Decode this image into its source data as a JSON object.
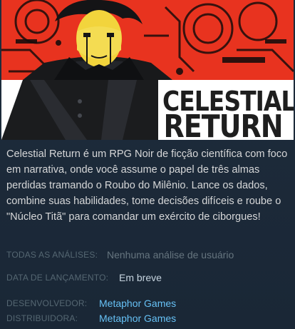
{
  "game": {
    "logo_line1": "CELESTIAL",
    "logo_line2": "RETURN",
    "description": "Celestial Return é um RPG Noir de ficção científica com foco em narrativa, onde você assume o papel de três almas perdidas tramando o Roubo do Milênio. Lance os dados, combine suas habilidades, tome decisões difíceis e roube o \"Núcleo Titã\" para comandar um exército de ciborgues!"
  },
  "info": {
    "reviews_label": "TODAS AS ANÁLISES:",
    "reviews_value": "Nenhuma análise de usuário",
    "release_label": "DATA DE LANÇAMENTO:",
    "release_value": "Em breve",
    "developer_label": "DESENVOLVEDOR:",
    "developer_value": "Metaphor Games",
    "publisher_label": "DISTRIBUIDORA:",
    "publisher_value": "Metaphor Games"
  },
  "colors": {
    "background": "#1b2838",
    "art_red": "#e8331f",
    "link": "#66c0f4",
    "label": "#556772",
    "text": "#d6d7d8"
  }
}
